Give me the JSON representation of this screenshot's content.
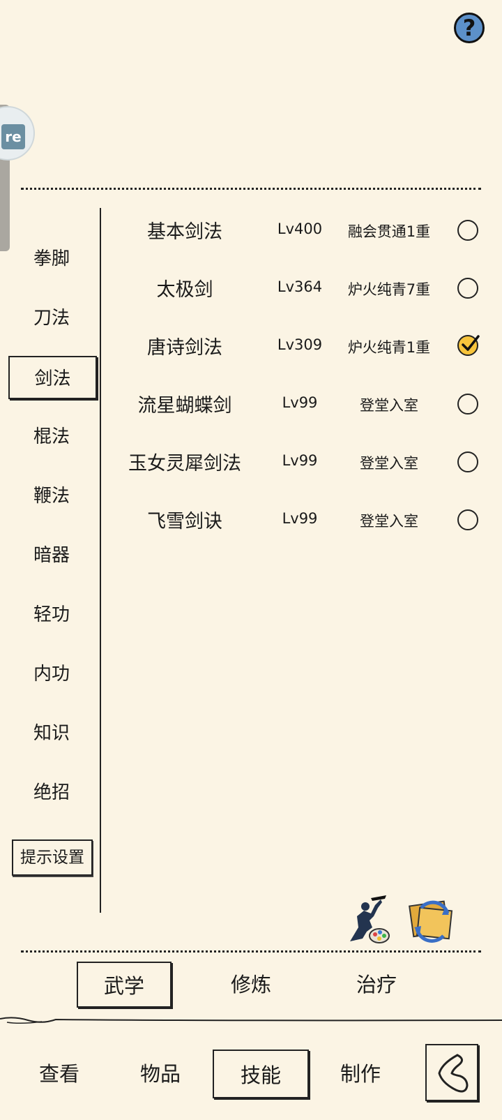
{
  "help": {
    "glyph": "?"
  },
  "float_widget": {
    "logo": "re"
  },
  "categories": [
    {
      "label": "拳脚",
      "active": false
    },
    {
      "label": "刀法",
      "active": false
    },
    {
      "label": "剑法",
      "active": true
    },
    {
      "label": "棍法",
      "active": false
    },
    {
      "label": "鞭法",
      "active": false
    },
    {
      "label": "暗器",
      "active": false
    },
    {
      "label": "轻功",
      "active": false
    },
    {
      "label": "内功",
      "active": false
    },
    {
      "label": "知识",
      "active": false
    },
    {
      "label": "绝招",
      "active": false
    }
  ],
  "tips_settings_label": "提示设置",
  "skills": [
    {
      "name": "基本剑法",
      "level": "Lv400",
      "stage": "融会贯通1重",
      "selected": false
    },
    {
      "name": "太极剑",
      "level": "Lv364",
      "stage": "炉火纯青7重",
      "selected": false
    },
    {
      "name": "唐诗剑法",
      "level": "Lv309",
      "stage": "炉火纯青1重",
      "selected": true
    },
    {
      "name": "流星蝴蝶剑",
      "level": "Lv99",
      "stage": "登堂入室",
      "selected": false
    },
    {
      "name": "玉女灵犀剑法",
      "level": "Lv99",
      "stage": "登堂入室",
      "selected": false
    },
    {
      "name": "飞雪剑诀",
      "level": "Lv99",
      "stage": "登堂入室",
      "selected": false
    }
  ],
  "subtabs": [
    {
      "label": "武学",
      "active": true
    },
    {
      "label": "修炼",
      "active": false
    },
    {
      "label": "治疗",
      "active": false
    }
  ],
  "nav": [
    {
      "label": "查看",
      "active": false
    },
    {
      "label": "物品",
      "active": false
    },
    {
      "label": "技能",
      "active": true
    },
    {
      "label": "制作",
      "active": false
    }
  ],
  "colors": {
    "background": "#fbf4e4",
    "checked_radio": "#f7c43c",
    "help_button": "#5c90c9"
  }
}
